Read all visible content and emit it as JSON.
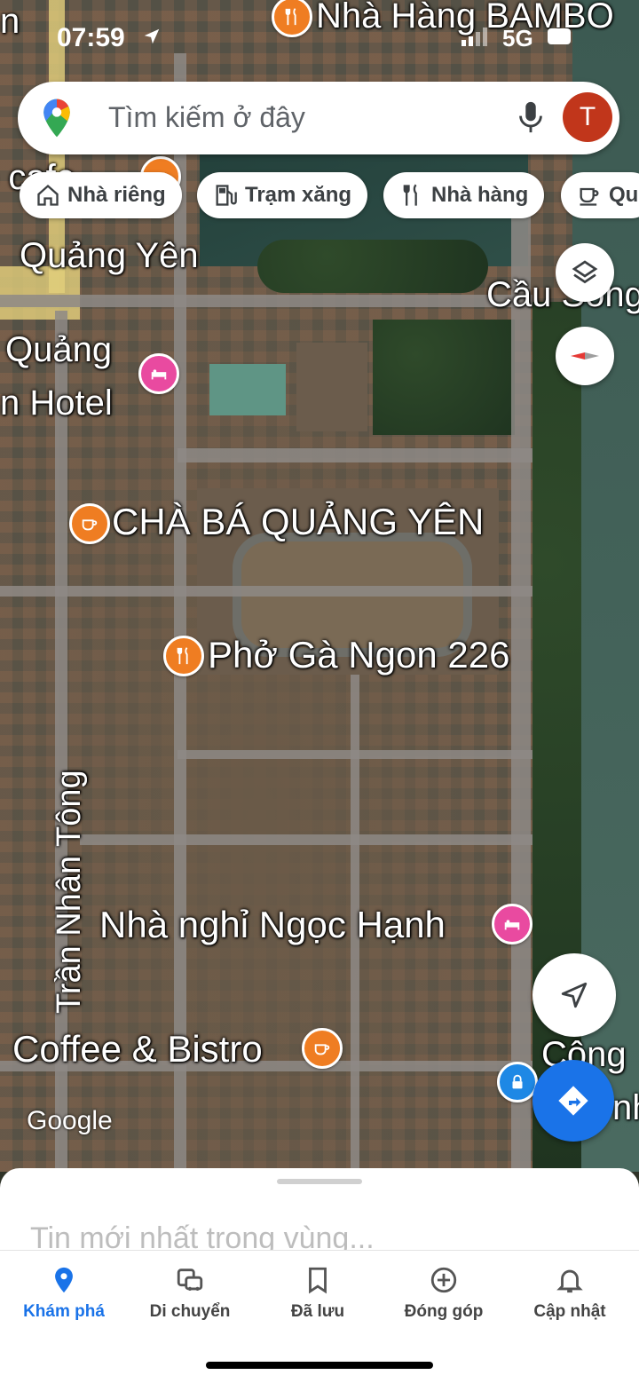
{
  "status_bar": {
    "time": "07:59",
    "network": "5G"
  },
  "search": {
    "placeholder": "Tìm kiếm ở đây",
    "avatar_initial": "T"
  },
  "chips": [
    {
      "label": "Nhà riêng",
      "icon": "home-icon"
    },
    {
      "label": "Trạm xăng",
      "icon": "gas-station-icon"
    },
    {
      "label": "Nhà hàng",
      "icon": "restaurant-icon"
    },
    {
      "label": "Qu",
      "icon": "cafe-icon"
    }
  ],
  "map": {
    "labels": {
      "top_restaurant": "Nhà Hàng BAMBO",
      "top_left_fragment": "n",
      "top_left_cafe_fragment": "o cafe",
      "quang_yen": "Quảng Yên",
      "bridge": "Cầu Sông",
      "hotel_line1": "Quảng",
      "hotel_line2": "n Hotel",
      "cha_ba": "CHÀ BÁ QUẢNG YÊN",
      "pho_ga": "Phở Gà Ngon 226",
      "road_tran_nhan_tong": "Trần Nhân Tông",
      "nha_nghi": "Nhà nghỉ Ngọc Hạnh",
      "coffee_bistro": "Coffee & Bistro",
      "cong_fragment_1": "Công",
      "cong_fragment_2": "nh",
      "google": "Google"
    },
    "pins": [
      {
        "name": "restaurant-pin-icon",
        "color": "#ef7d22"
      },
      {
        "name": "hotel-pin-icon",
        "color": "#e94aa0"
      },
      {
        "name": "cafe-pin-icon",
        "color": "#ef7d22"
      },
      {
        "name": "lock-pin-icon",
        "color": "#1e88e5"
      }
    ]
  },
  "sheet": {
    "teaser": "Tin mới nhất trong vùng..."
  },
  "nav": [
    {
      "label": "Khám phá",
      "icon": "explore-pin-icon",
      "active": true
    },
    {
      "label": "Di chuyển",
      "icon": "commute-icon",
      "active": false
    },
    {
      "label": "Đã lưu",
      "icon": "bookmark-icon",
      "active": false
    },
    {
      "label": "Đóng góp",
      "icon": "add-circle-icon",
      "active": false
    },
    {
      "label": "Cập nhật",
      "icon": "bell-icon",
      "active": false
    }
  ],
  "colors": {
    "accent": "#1a73e8",
    "avatar": "#c1361b",
    "restaurant_pin": "#ef7d22",
    "hotel_pin": "#e94aa0"
  }
}
